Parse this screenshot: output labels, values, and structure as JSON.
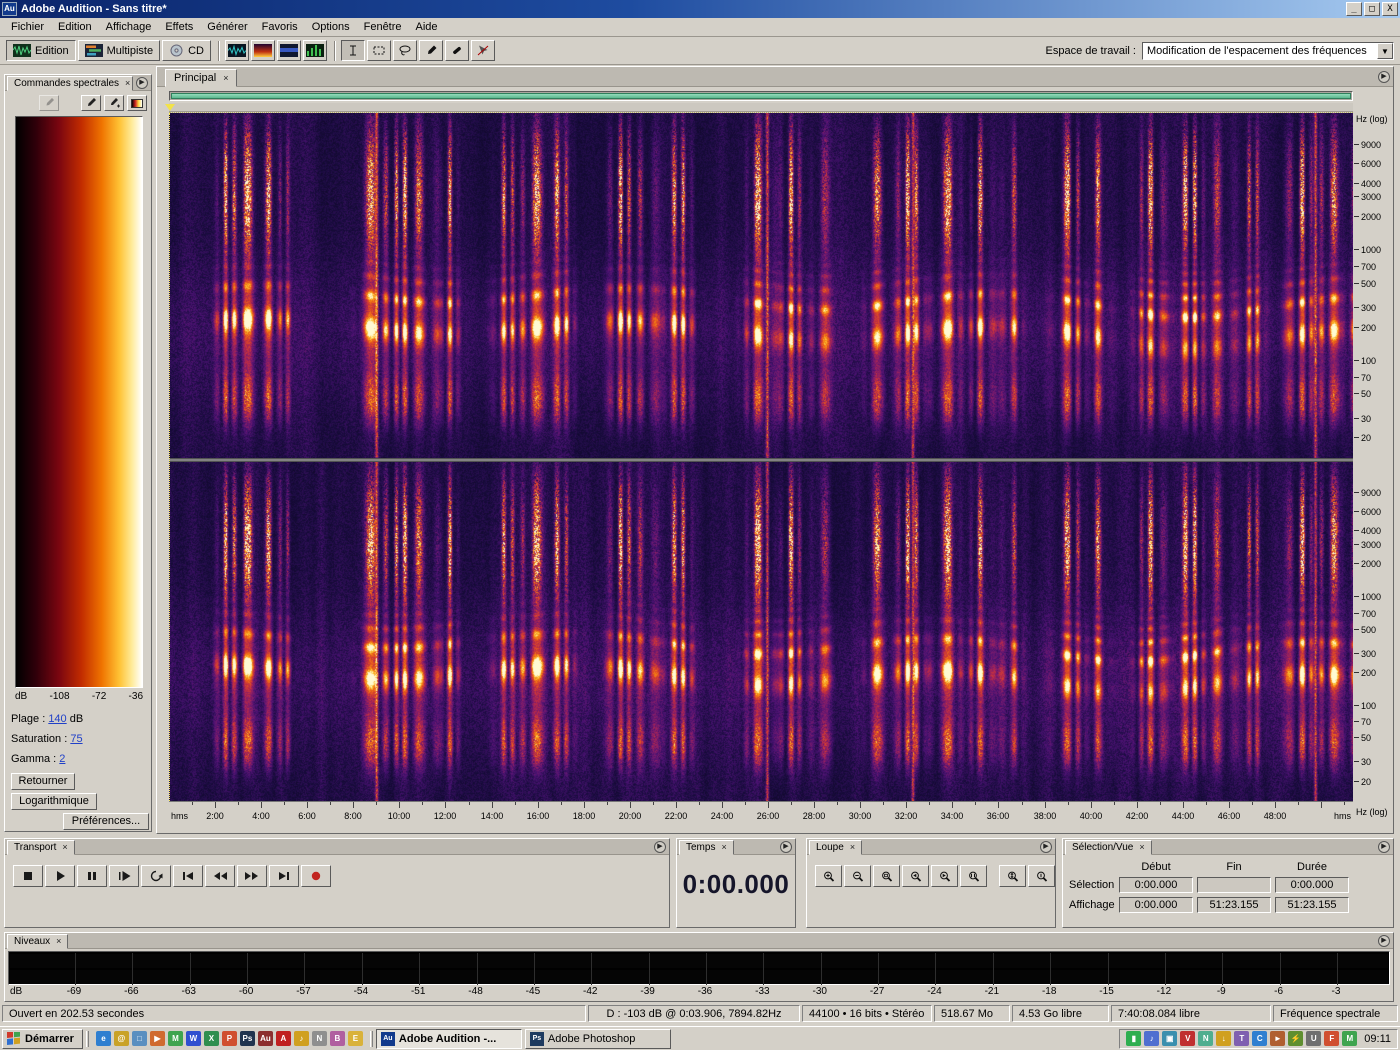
{
  "window": {
    "title": "Adobe Audition - Sans titre*",
    "icon": "Au",
    "controls": {
      "minimize": "_",
      "maximize": "□",
      "close": "X"
    }
  },
  "menu": {
    "items": [
      "Fichier",
      "Edition",
      "Affichage",
      "Effets",
      "Générer",
      "Favoris",
      "Options",
      "Fenêtre",
      "Aide"
    ]
  },
  "toolbar": {
    "modes": [
      {
        "label": "Edition",
        "icon": "waveform-edit-icon",
        "active": true
      },
      {
        "label": "Multipiste",
        "icon": "multitrack-icon",
        "active": false
      },
      {
        "label": "CD",
        "icon": "cd-icon",
        "active": false
      }
    ],
    "view_buttons": [
      "waveform-view-icon",
      "spectral-frequency-view-icon",
      "spectral-pan-view-icon",
      "spectral-phase-view-icon"
    ],
    "tools": [
      "ibeam-tool",
      "marquee-tool",
      "lasso-tool",
      "paintbrush-tool",
      "healing-brush-tool",
      "scrub-tool"
    ],
    "active_tool": "ibeam-tool",
    "workspace_label": "Espace de travail :",
    "workspace_value": "Modification de l'espacement des fréquences"
  },
  "spectral_controls": {
    "title": "Commandes spectrales",
    "tool_icons": [
      "spectral-brush-icon",
      "eyedropper-icon",
      "eyedropper-plus-icon",
      "gradient-swatch-icon"
    ],
    "palette_css": "linear-gradient(90deg,#000000 0%,#30000a 16%,#7a0610 34%,#c22c00 52%,#ef7300 68%,#ffc234 82%,#ffeb9a 92%,#ffffff 100%)",
    "db_axis": {
      "unit": "dB",
      "ticks": [
        "-108",
        "-72",
        "-36"
      ]
    },
    "fields": [
      {
        "label": "Plage :",
        "value": "140",
        "suffix": "dB"
      },
      {
        "label": "Saturation :",
        "value": "75",
        "suffix": ""
      },
      {
        "label": "Gamma :",
        "value": "2",
        "suffix": ""
      }
    ],
    "buttons": {
      "flip": "Retourner",
      "log": "Logarithmique",
      "prefs": "Préférences..."
    }
  },
  "main_view": {
    "tab": "Principal",
    "freq_axis_unit": "Hz (log)",
    "freq_labels": [
      9000,
      6000,
      4000,
      3000,
      2000,
      1000,
      700,
      500,
      300,
      200,
      100,
      70,
      50,
      30,
      20
    ],
    "freq_min": 13,
    "freq_max": 17000,
    "time_unit": "hms",
    "time_labels": [
      "2:00",
      "4:00",
      "6:00",
      "8:00",
      "10:00",
      "12:00",
      "14:00",
      "16:00",
      "18:00",
      "20:00",
      "22:00",
      "24:00",
      "26:00",
      "28:00",
      "30:00",
      "32:00",
      "34:00",
      "36:00",
      "38:00",
      "40:00",
      "42:00",
      "44:00",
      "46:00",
      "48:00"
    ],
    "duration_seconds": 3083.155,
    "channels": 2
  },
  "panels": {
    "transport": {
      "title": "Transport",
      "buttons": [
        "stop",
        "play",
        "pause",
        "play-from-cursor",
        "play-loop",
        "go-start",
        "rewind",
        "forward",
        "go-end",
        "record"
      ]
    },
    "time": {
      "title": "Temps",
      "value": "0:00.000"
    },
    "zoom": {
      "title": "Loupe",
      "buttons": [
        "zoom-in-h",
        "zoom-out-h",
        "zoom-full",
        "zoom-sel-left",
        "zoom-sel-right",
        "zoom-sel",
        "zoom-in-v",
        "zoom-out-v"
      ]
    },
    "selection": {
      "title": "Sélection/Vue",
      "columns": [
        "Début",
        "Fin",
        "Durée"
      ],
      "rows": [
        {
          "label": "Sélection",
          "debut": "0:00.000",
          "fin": "",
          "duree": "0:00.000"
        },
        {
          "label": "Affichage",
          "debut": "0:00.000",
          "fin": "51:23.155",
          "duree": "51:23.155"
        }
      ]
    },
    "levels": {
      "title": "Niveaux",
      "unit": "dB",
      "scale": [
        -69,
        -66,
        -63,
        -60,
        -57,
        -54,
        -51,
        -48,
        -45,
        -42,
        -39,
        -36,
        -33,
        -30,
        -27,
        -24,
        -21,
        -18,
        -15,
        -12,
        -9,
        -6,
        -3
      ]
    }
  },
  "status_bar": {
    "cells": [
      "Ouvert en 202.53 secondes",
      "D : -103 dB @  0:03.906, 7894.82Hz",
      "44100 • 16 bits • Stéréo",
      "518.67 Mo",
      "4.53 Go libre",
      "7:40:08.084 libre",
      "Fréquence spectrale"
    ]
  },
  "taskbar": {
    "start": "Démarrer",
    "quick_launch": [
      {
        "name": "internet-explorer-icon",
        "color": "#2f7fd0",
        "glyph": "e"
      },
      {
        "name": "outlook-icon",
        "color": "#c9a227",
        "glyph": "@"
      },
      {
        "name": "show-desktop-icon",
        "color": "#5a8fc0",
        "glyph": "□"
      },
      {
        "name": "media-player-icon",
        "color": "#d06a2f",
        "glyph": "▶"
      },
      {
        "name": "messenger-icon",
        "color": "#3fa44f",
        "glyph": "M"
      },
      {
        "name": "word-icon",
        "color": "#2f4fd0",
        "glyph": "W"
      },
      {
        "name": "excel-icon",
        "color": "#2f8f4f",
        "glyph": "X"
      },
      {
        "name": "powerpoint-icon",
        "color": "#d04f2f",
        "glyph": "P"
      },
      {
        "name": "photoshop-icon",
        "color": "#20344f",
        "glyph": "Ps"
      },
      {
        "name": "audition-icon",
        "color": "#8c2f2f",
        "glyph": "Au"
      },
      {
        "name": "acrobat-icon",
        "color": "#c02020",
        "glyph": "A"
      },
      {
        "name": "winamp-icon",
        "color": "#d0a020",
        "glyph": "♪"
      },
      {
        "name": "notepad-icon",
        "color": "#8f8f8f",
        "glyph": "N"
      },
      {
        "name": "paint-icon",
        "color": "#b05fa0",
        "glyph": "B"
      },
      {
        "name": "explorer-icon",
        "color": "#d9b23a",
        "glyph": "E"
      }
    ],
    "tasks": [
      {
        "label": "Adobe Audition -...",
        "icon": "Au",
        "icon_color": "#123a8c",
        "active": true
      },
      {
        "label": "Adobe Photoshop",
        "icon": "Ps",
        "icon_color": "#1d3a5f",
        "active": false
      }
    ],
    "tray_icons": [
      {
        "name": "cpu-meter-icon",
        "color": "#2fae4f",
        "glyph": "▮"
      },
      {
        "name": "volume-icon",
        "color": "#4f6fd0",
        "glyph": "♪"
      },
      {
        "name": "display-icon",
        "color": "#3a8fae",
        "glyph": "▣"
      },
      {
        "name": "antivirus-icon",
        "color": "#c03030",
        "glyph": "V"
      },
      {
        "name": "network-icon",
        "color": "#4fae8f",
        "glyph": "N"
      },
      {
        "name": "update-icon",
        "color": "#d0a020",
        "glyph": "↓"
      },
      {
        "name": "scheduler-icon",
        "color": "#7f5fb0",
        "glyph": "T"
      },
      {
        "name": "chat-icon",
        "color": "#2f7fd0",
        "glyph": "C"
      },
      {
        "name": "video-icon",
        "color": "#b05f2f",
        "glyph": "►"
      },
      {
        "name": "power-icon",
        "color": "#5f8f2f",
        "glyph": "⚡"
      },
      {
        "name": "usb-icon",
        "color": "#6f6f6f",
        "glyph": "U"
      },
      {
        "name": "firewall-icon",
        "color": "#d04f2f",
        "glyph": "F"
      },
      {
        "name": "messenger-tray-icon",
        "color": "#3fa44f",
        "glyph": "M"
      }
    ],
    "clock": "09:11"
  },
  "spectrogram": {
    "seed": 1337,
    "freq_min": 13,
    "freq_max": 17000,
    "palette": [
      [
        0,
        6,
        4,
        20
      ],
      [
        0.13,
        26,
        12,
        64
      ],
      [
        0.28,
        74,
        18,
        114
      ],
      [
        0.42,
        128,
        28,
        108
      ],
      [
        0.55,
        186,
        42,
        72
      ],
      [
        0.68,
        226,
        78,
        34
      ],
      [
        0.8,
        246,
        136,
        18
      ],
      [
        0.9,
        252,
        198,
        60
      ],
      [
        1,
        255,
        250,
        210
      ]
    ],
    "bursts": [
      [
        0.05,
        0.01,
        0.9
      ],
      [
        0.065,
        0.008,
        1
      ],
      [
        0.082,
        0.01,
        0.85
      ],
      [
        0.097,
        0.006,
        0.7
      ],
      [
        0.175,
        0.012,
        1
      ],
      [
        0.196,
        0.01,
        0.95
      ],
      [
        0.216,
        0.012,
        0.9
      ],
      [
        0.236,
        0.008,
        0.8
      ],
      [
        0.285,
        0.01,
        0.8
      ],
      [
        0.307,
        0.012,
        0.9
      ],
      [
        0.33,
        0.01,
        0.85
      ],
      [
        0.382,
        0.012,
        0.9
      ],
      [
        0.403,
        0.01,
        0.8
      ],
      [
        0.43,
        0.012,
        0.85
      ],
      [
        0.5,
        0.012,
        1
      ],
      [
        0.525,
        0.01,
        0.9
      ],
      [
        0.55,
        0.008,
        0.8
      ],
      [
        0.6,
        0.01,
        0.8
      ],
      [
        0.625,
        0.012,
        0.95
      ],
      [
        0.655,
        0.012,
        0.9
      ],
      [
        0.686,
        0.01,
        0.85
      ],
      [
        0.71,
        0.008,
        0.8
      ],
      [
        0.76,
        0.012,
        0.9
      ],
      [
        0.786,
        0.008,
        0.8
      ],
      [
        0.83,
        0.012,
        0.95
      ],
      [
        0.862,
        0.012,
        1
      ],
      [
        0.89,
        0.01,
        0.85
      ],
      [
        0.915,
        0.008,
        0.8
      ],
      [
        0.955,
        0.012,
        0.95
      ],
      [
        0.98,
        0.01,
        0.9
      ],
      [
        0.996,
        0.008,
        0.85
      ]
    ],
    "clicks": [
      0.175,
      0.505,
      0.628,
      0.968
    ]
  }
}
